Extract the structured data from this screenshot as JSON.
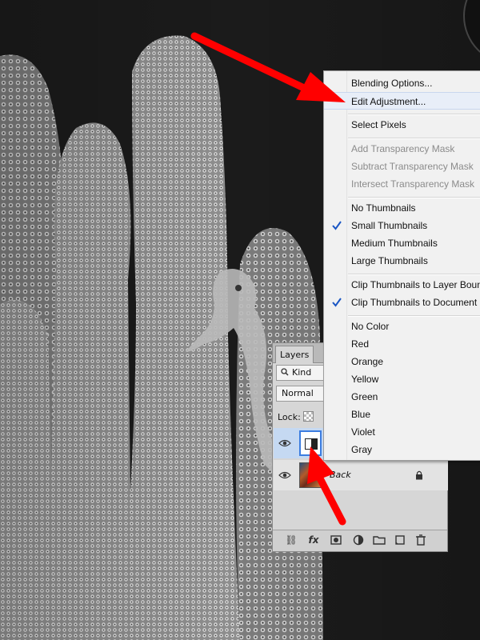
{
  "menu": {
    "items": {
      "blending_options": "Blending Options...",
      "edit_adjustment": "Edit Adjustment...",
      "select_pixels": "Select Pixels",
      "add_transparency_mask": "Add Transparency Mask",
      "subtract_transparency_mask": "Subtract Transparency Mask",
      "intersect_transparency_mask": "Intersect Transparency Mask",
      "no_thumbnails": "No Thumbnails",
      "small_thumbnails": "Small Thumbnails",
      "medium_thumbnails": "Medium Thumbnails",
      "large_thumbnails": "Large Thumbnails",
      "clip_layer_bounds": "Clip Thumbnails to Layer Bounds",
      "clip_document_bounds": "Clip Thumbnails to Document Bounds",
      "no_color": "No Color",
      "red": "Red",
      "orange": "Orange",
      "yellow": "Yellow",
      "green": "Green",
      "blue": "Blue",
      "violet": "Violet",
      "gray": "Gray"
    },
    "checked": [
      "small_thumbnails",
      "clip_document_bounds"
    ],
    "highlighted": "edit_adjustment"
  },
  "layers_panel": {
    "tab_label": "Layers",
    "filter_kind": "Kind",
    "blend_mode": "Normal",
    "lock_label": "Lock:",
    "layers": [
      {
        "name": "",
        "type": "adjustment",
        "visible": true,
        "selected": true
      },
      {
        "name": "Back",
        "type": "image",
        "visible": true,
        "locked": true
      }
    ],
    "footer_icons": [
      "link-icon",
      "fx-icon",
      "mask-icon",
      "adjustment-icon",
      "folder-icon",
      "new-layer-icon",
      "trash-icon"
    ],
    "footer_fx_label": "fx"
  },
  "colors": {
    "menu_bg": "#f1f1f1",
    "menu_highlight": "#e8eef8",
    "check_mark": "#1a56c4",
    "arrow": "#ff0000",
    "selected_layer": "#c5d9f2"
  }
}
